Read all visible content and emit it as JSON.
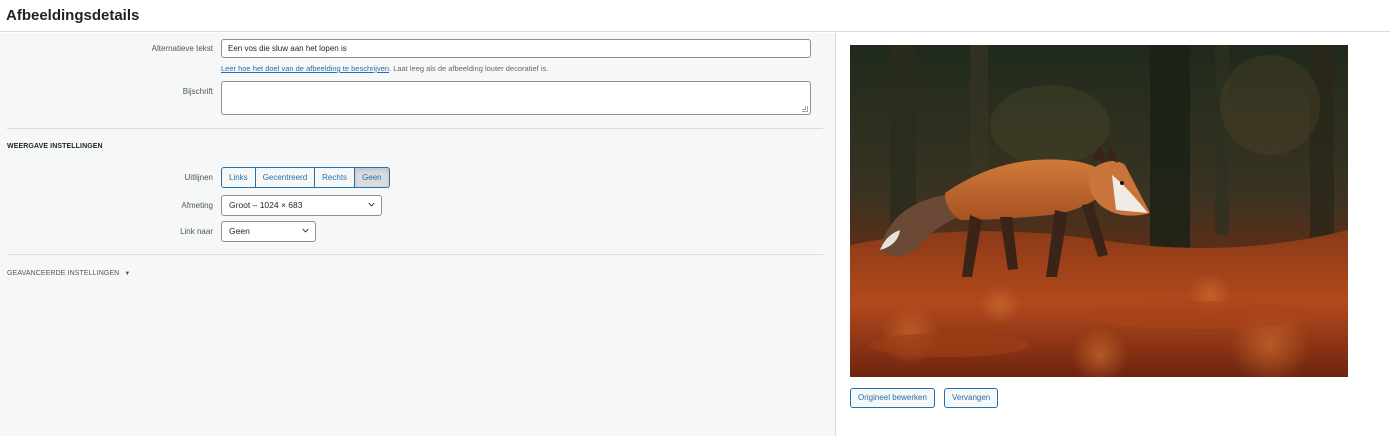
{
  "header": {
    "title": "Afbeeldingsdetails"
  },
  "fields": {
    "alt": {
      "label": "Alternatieve tekst",
      "value": "Een vos die sluw aan het lopen is",
      "help_link": "Leer hoe het doel van de afbeelding te beschrijven",
      "help_rest": ". Laat leeg als de afbeelding louter decoratief is."
    },
    "caption": {
      "label": "Bijschrift",
      "value": ""
    }
  },
  "display": {
    "section_title": "WEERGAVE INSTELLINGEN",
    "align": {
      "label": "Uitlijnen",
      "options": [
        "Links",
        "Gecentreerd",
        "Rechts",
        "Geen"
      ],
      "selected": "Geen"
    },
    "size": {
      "label": "Afmeting",
      "value": "Groot – 1024 × 683"
    },
    "link": {
      "label": "Link naar",
      "value": "Geen"
    }
  },
  "advanced": {
    "title": "GEAVANCEERDE INSTELLINGEN",
    "arrow": "▼"
  },
  "image": {
    "subject": "red fox walking on autumn leaves"
  },
  "actions": {
    "edit_original": "Origineel bewerken",
    "replace": "Vervangen"
  },
  "colors": {
    "accent": "#2271b1",
    "panel_bg": "#f6f7f7",
    "border": "#dcdcde"
  }
}
